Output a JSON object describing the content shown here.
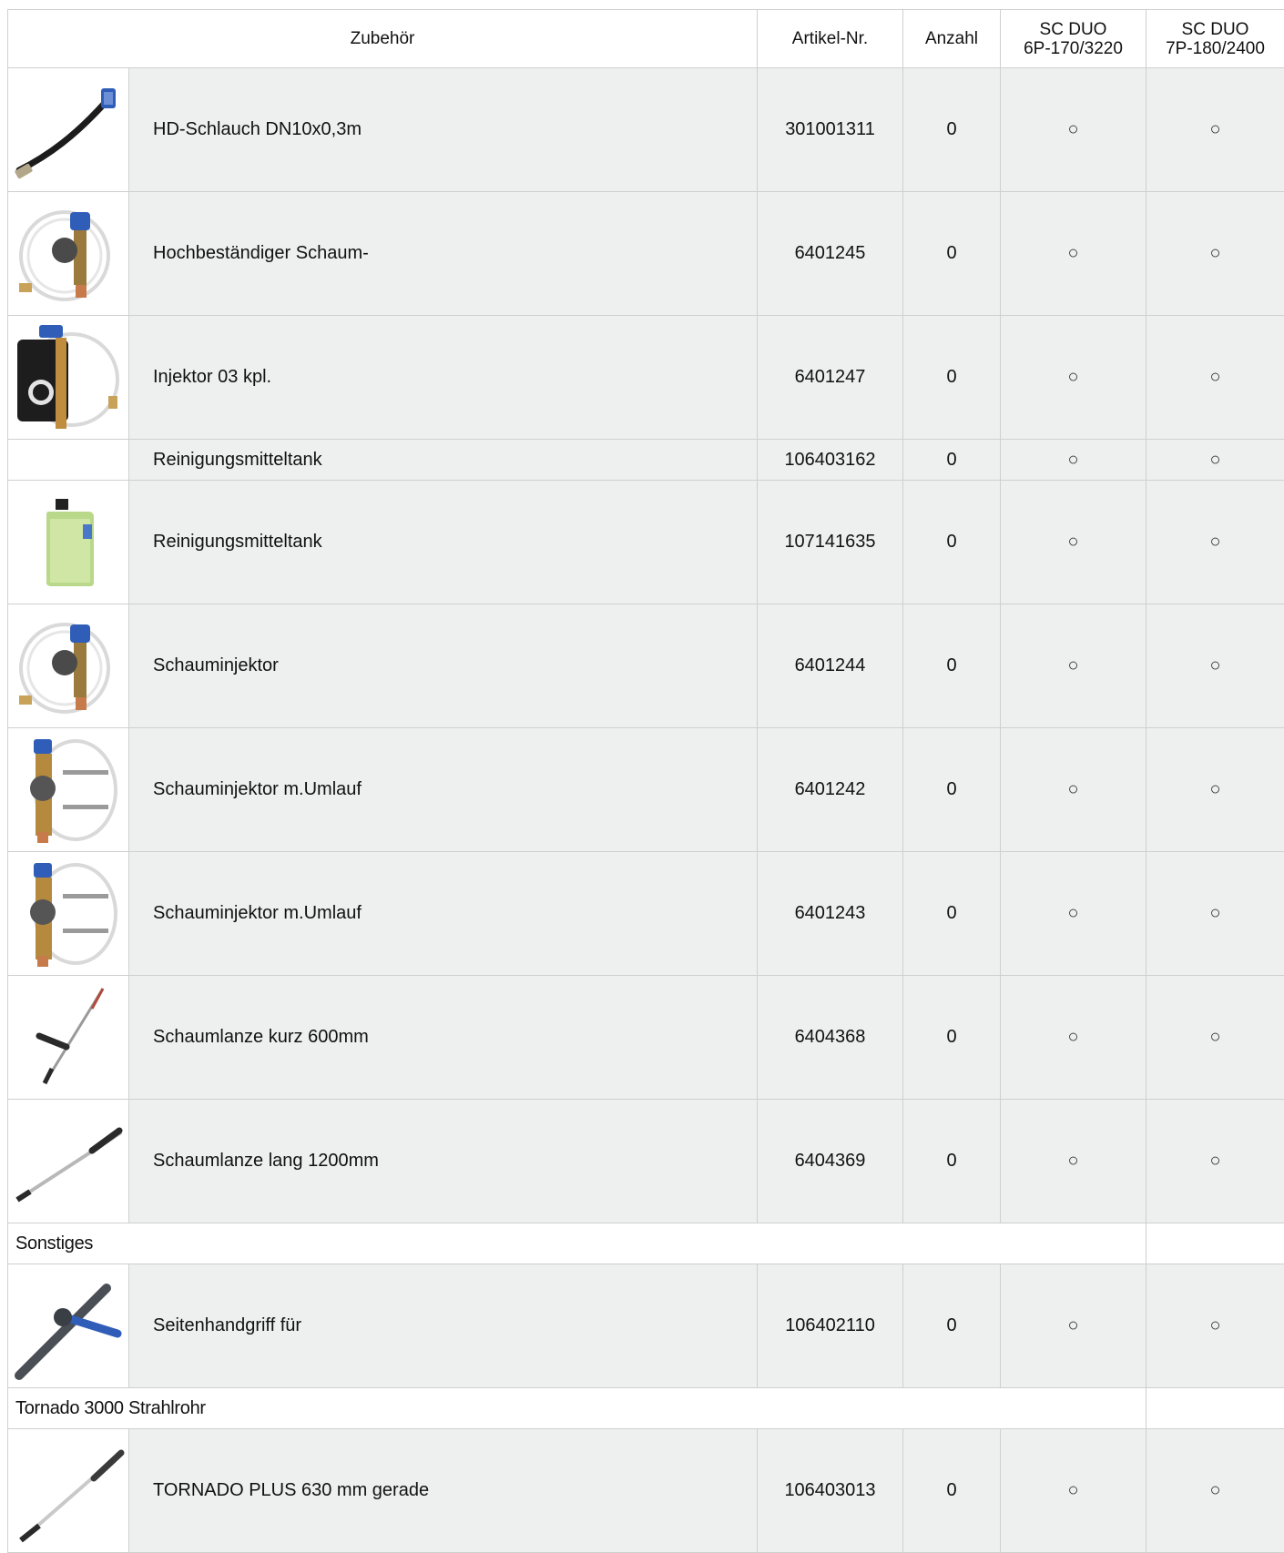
{
  "header": {
    "zubehoer": "Zubehör",
    "artikel": "Artikel-Nr.",
    "anzahl": "Anzahl",
    "model1_line1": "SC DUO",
    "model1_line2": "6P-170/3220",
    "model2_line1": "SC DUO",
    "model2_line2": "7P-180/2400"
  },
  "rows": [
    {
      "name": "HD-Schlauch DN10x0,3m",
      "artikel": "301001311",
      "anzahl": "0",
      "m1": "○",
      "m2": "○",
      "image": "hose-icon"
    },
    {
      "name": "Hochbeständiger Schaum-",
      "artikel": "6401245",
      "anzahl": "0",
      "m1": "○",
      "m2": "○",
      "image": "foam-injector-icon"
    },
    {
      "name": "Injektor 03 kpl.",
      "artikel": "6401247",
      "anzahl": "0",
      "m1": "○",
      "m2": "○",
      "image": "injector-icon"
    },
    {
      "name": "Reinigungsmitteltank",
      "artikel": "106403162",
      "anzahl": "0",
      "m1": "○",
      "m2": "○",
      "image": ""
    },
    {
      "name": "Reinigungsmitteltank",
      "artikel": "107141635",
      "anzahl": "0",
      "m1": "○",
      "m2": "○",
      "image": "canister-icon"
    },
    {
      "name": "Schauminjektor",
      "artikel": "6401244",
      "anzahl": "0",
      "m1": "○",
      "m2": "○",
      "image": "foam-injector-icon"
    },
    {
      "name": "Schauminjektor m.Umlauf",
      "artikel": "6401242",
      "anzahl": "0",
      "m1": "○",
      "m2": "○",
      "image": "bypass-injector-icon"
    },
    {
      "name": "Schauminjektor m.Umlauf",
      "artikel": "6401243",
      "anzahl": "0",
      "m1": "○",
      "m2": "○",
      "image": "bypass-injector-icon"
    },
    {
      "name": "Schaumlanze kurz 600mm",
      "artikel": "6404368",
      "anzahl": "0",
      "m1": "○",
      "m2": "○",
      "image": "short-lance-icon"
    },
    {
      "name": "Schaumlanze lang 1200mm",
      "artikel": "6404369",
      "anzahl": "0",
      "m1": "○",
      "m2": "○",
      "image": "long-lance-icon"
    }
  ],
  "section_sonstiges": {
    "title": "Sonstiges",
    "rows": [
      {
        "name": "Seitenhandgriff für",
        "artikel": "106402110",
        "anzahl": "0",
        "m1": "○",
        "m2": "○",
        "image": "side-handle-icon"
      }
    ]
  },
  "section_tornado": {
    "title": "Tornado 3000 Strahlrohr",
    "rows": [
      {
        "name": "TORNADO PLUS 630 mm gerade",
        "artikel": "106403013",
        "anzahl": "0",
        "m1": "○",
        "m2": "○",
        "image": "spray-lance-icon"
      }
    ]
  }
}
